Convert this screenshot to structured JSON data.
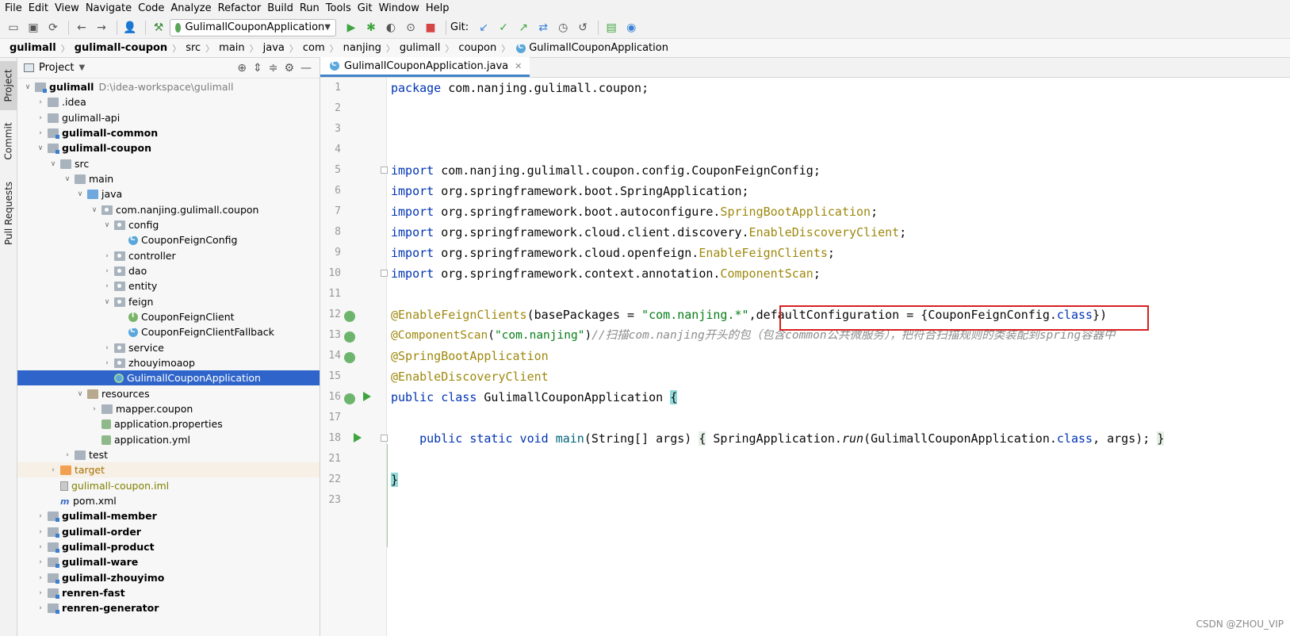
{
  "menu": [
    "File",
    "Edit",
    "View",
    "Navigate",
    "Code",
    "Analyze",
    "Refactor",
    "Build",
    "Run",
    "Tools",
    "Git",
    "Window",
    "Help"
  ],
  "toolbar": {
    "run_config": "GulimallCouponApplication",
    "git_label": "Git:"
  },
  "breadcrumb": [
    "gulimall",
    "gulimall-coupon",
    "src",
    "main",
    "java",
    "com",
    "nanjing",
    "gulimall",
    "coupon",
    "GulimallCouponApplication"
  ],
  "left_strip": [
    "Project",
    "Commit",
    "Pull Requests"
  ],
  "project": {
    "title": "Project",
    "root": {
      "name": "gulimall",
      "path": "D:\\idea-workspace\\gulimall"
    },
    "items": [
      ".idea",
      "gulimall-api",
      "gulimall-common",
      "gulimall-coupon",
      "src",
      "main",
      "java",
      "com.nanjing.gulimall.coupon",
      "config",
      "CouponFeignConfig",
      "controller",
      "dao",
      "entity",
      "feign",
      "CouponFeignClient",
      "CouponFeignClientFallback",
      "service",
      "zhouyimoaop",
      "GulimallCouponApplication",
      "resources",
      "mapper.coupon",
      "application.properties",
      "application.yml",
      "test",
      "target",
      "gulimall-coupon.iml",
      "pom.xml",
      "gulimall-member",
      "gulimall-order",
      "gulimall-product",
      "gulimall-ware",
      "gulimall-zhouyimo",
      "renren-fast",
      "renren-generator"
    ]
  },
  "editor": {
    "tab": "GulimallCouponApplication.java",
    "line_numbers": [
      "1",
      "2",
      "3",
      "4",
      "5",
      "6",
      "7",
      "8",
      "9",
      "10",
      "11",
      "12",
      "13",
      "14",
      "15",
      "16",
      "17",
      "18",
      "21",
      "22",
      "23"
    ],
    "code": {
      "l1a": "package",
      "l1b": " com.nanjing.gulimall.coupon;",
      "imp": "import",
      "l5": " com.nanjing.gulimall.coupon.config.CouponFeignConfig;",
      "l6": " org.springframework.boot.SpringApplication;",
      "l7a": " org.springframework.boot.autoconfigure.",
      "l7b": "SpringBootApplication",
      "l7c": ";",
      "l8a": " org.springframework.cloud.client.discovery.",
      "l8b": "EnableDiscoveryClient",
      "l8c": ";",
      "l9a": " org.springframework.cloud.openfeign.",
      "l9b": "EnableFeignClients",
      "l9c": ";",
      "l10a": " org.springframework.context.annotation.",
      "l10b": "ComponentScan",
      "l10c": ";",
      "l12a": "@EnableFeignClients",
      "l12b": "(basePackages = ",
      "l12c": "\"com.nanjing.*\"",
      "l12d": ",defaultConfiguration = {CouponFeignConfig.",
      "l12e": "class",
      "l12f": "})",
      "l13a": "@ComponentScan",
      "l13b": "(",
      "l13c": "\"com.nanjing\"",
      "l13d": ")",
      "l13e": "//扫描com.nanjing开头的包（包含common公共微服务），把符合扫描规则的类装配到spring容器中",
      "l14": "@SpringBootApplication",
      "l15": "@EnableDiscoveryClient",
      "l16a": "public class",
      "l16b": " GulimallCouponApplication ",
      "l16c": "{",
      "l18a": "    public static void",
      "l18b": " main",
      "l18c": "(String[] args) ",
      "l18d": "{",
      "l18e": " SpringApplication.",
      "l18f": "run",
      "l18g": "(GulimallCouponApplication.",
      "l18h": "class",
      "l18i": ", args); ",
      "l18j": "}",
      "l22": "}"
    }
  },
  "watermark": "CSDN @ZHOU_VIP"
}
